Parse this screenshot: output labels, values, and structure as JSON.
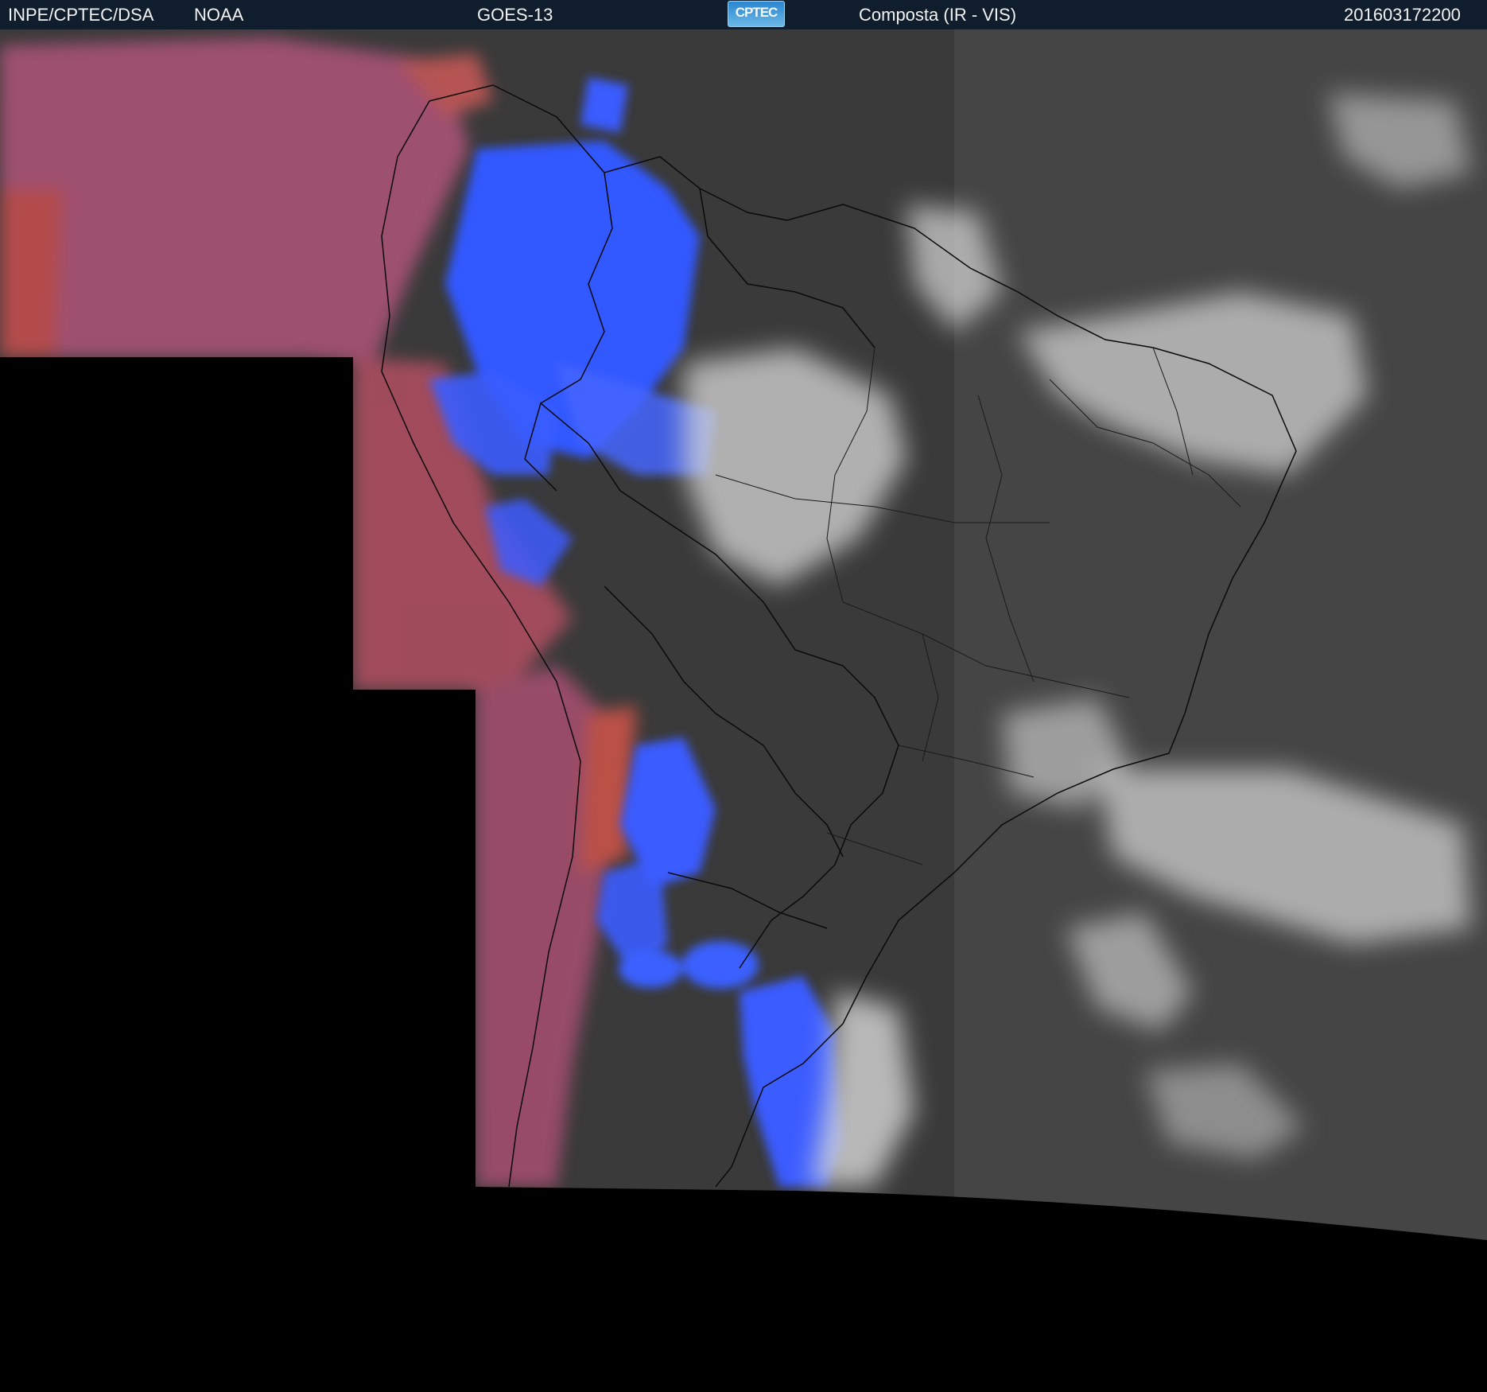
{
  "header": {
    "institution": "INPE/CPTEC/DSA",
    "agency": "NOAA",
    "satellite": "GOES-13",
    "logo_text": "CPTEC",
    "product": "Composta (IR - VIS)",
    "timestamp": "201603172200"
  },
  "colors": {
    "header_bg": "#0f1d2c",
    "no_data": "#000000",
    "ir_cold_cloud": "#3a5cff",
    "ir_warm_cloud": "#c85a5a",
    "vis_cloud": "#e6e6e6",
    "surface": "#3a3a3a"
  }
}
